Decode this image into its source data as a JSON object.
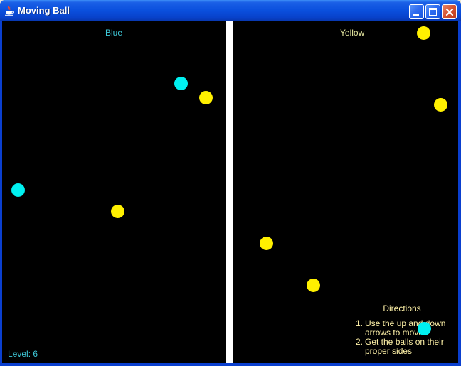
{
  "window": {
    "title": "Moving Ball",
    "controls": [
      "minimize-icon",
      "maximize-icon",
      "close-icon"
    ]
  },
  "game": {
    "sides": {
      "left_label": "Blue",
      "right_label": "Yellow"
    },
    "directions": {
      "title": "Directions",
      "steps": [
        {
          "num": "1.",
          "text": "Use the up and down arrows to move"
        },
        {
          "num": "2.",
          "text": "Get the balls on their proper sides"
        }
      ]
    },
    "level": "Level: 6",
    "balls": [
      {
        "color": "cyan"
      },
      {
        "color": "yellow"
      },
      {
        "color": "cyan"
      },
      {
        "color": "yellow"
      },
      {
        "color": "yellow"
      },
      {
        "color": "yellow"
      },
      {
        "color": "yellow"
      },
      {
        "color": "yellow"
      },
      {
        "color": "cyan"
      }
    ]
  },
  "colors": {
    "background": "#000000",
    "divider": "#FFFFFF",
    "blue_ball": "#00F0F0",
    "yellow_ball": "#FFF000",
    "title_bar": "#0A4FDD"
  }
}
